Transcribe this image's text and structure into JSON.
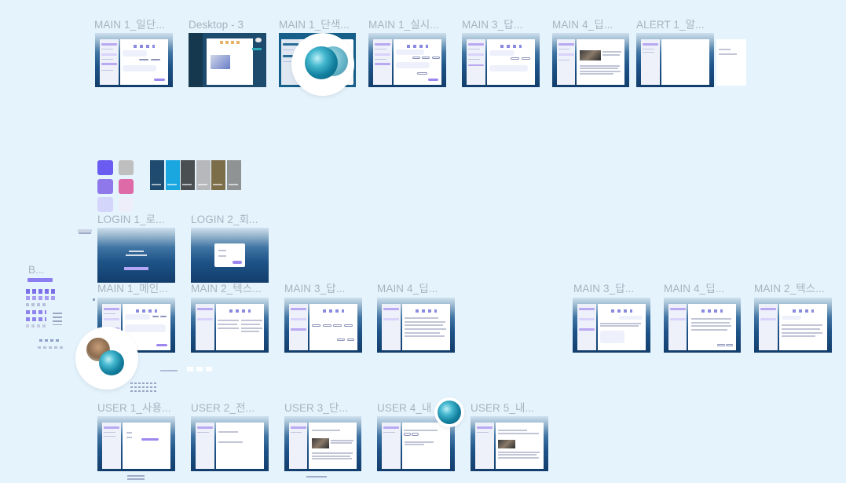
{
  "canvas": {
    "background": "#e5f3fd",
    "label_color": "#a6b4c0",
    "accent": "#9d87ee",
    "accent_light": "#d9d2fb"
  },
  "frames": {
    "main1_a": "MAIN 1_일단...",
    "desktop3": "Desktop - 3",
    "main1_b": "MAIN 1_단색...",
    "main1_c": "MAIN 1_실시...",
    "main3_a": "MAIN 3_답...",
    "main4_a": "MAIN 4_딥...",
    "alert1": "ALERT 1_알...",
    "login1": "LOGIN 1_로...",
    "login2": "LOGIN 2_회...",
    "b": "B...",
    "main1_d": "MAIN 1_메인...",
    "main2_a": "MAIN 2_텍스...",
    "main3_b": "MAIN 3_답...",
    "main4_b": "MAIN 4_딥...",
    "main3_c": "MAIN 3_답...",
    "main4_c": "MAIN 4_딥...",
    "main2_b": "MAIN 2_텍스...",
    "user1": "USER 1_사용...",
    "user2": "USER 2_전...",
    "user3": "USER 3_단...",
    "user4": "USER 4_내",
    "user5": "USER 5_내..."
  },
  "palette": {
    "swatches": [
      "#6a5cf0",
      "#bfbfbf",
      "#8f78ea",
      "#df6aa8",
      "#d4d5fa",
      "#eeeefb"
    ],
    "cards": [
      "#1f4b70",
      "#1aa7e0",
      "#4a4f51",
      "#b7b8bb",
      "#7d6e4a",
      "#8f9394"
    ]
  },
  "orbs": {
    "colors": [
      "#45b8cf",
      "#127f9e",
      "#0b5c78"
    ]
  }
}
